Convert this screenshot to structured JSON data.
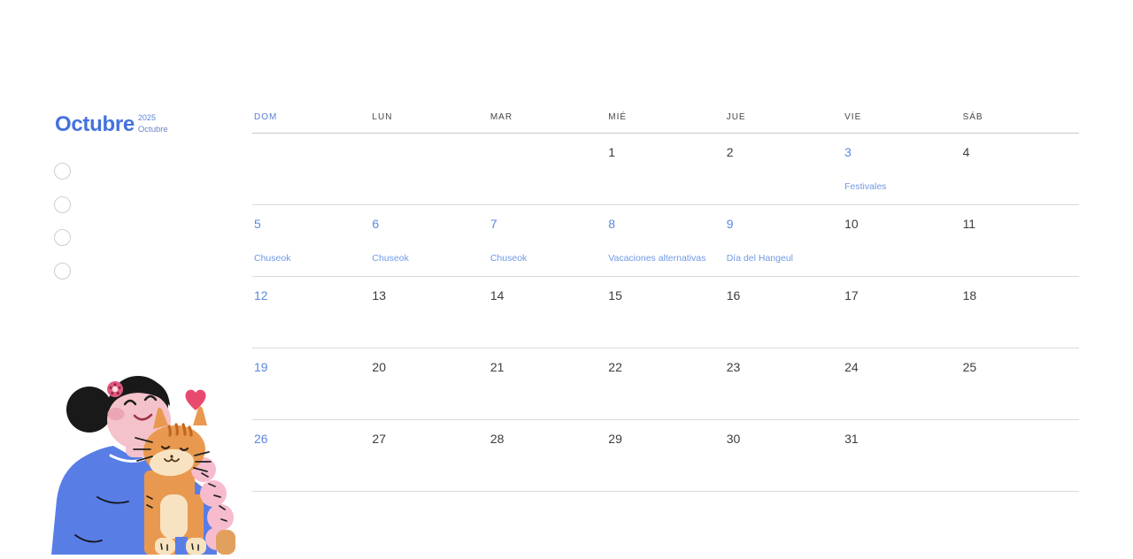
{
  "header": {
    "month_title": "Octubre",
    "year_small": "2025",
    "month_small": "Octubre"
  },
  "weekday_headers": [
    {
      "label": "DOM",
      "accent": true
    },
    {
      "label": "LUN",
      "accent": false
    },
    {
      "label": "MAR",
      "accent": false
    },
    {
      "label": "MIÉ",
      "accent": false
    },
    {
      "label": "JUE",
      "accent": false
    },
    {
      "label": "VIE",
      "accent": false
    },
    {
      "label": "SÁB",
      "accent": false
    }
  ],
  "calendar": {
    "weeks": [
      [
        {
          "day": ""
        },
        {
          "day": ""
        },
        {
          "day": ""
        },
        {
          "day": "1"
        },
        {
          "day": "2"
        },
        {
          "day": "3",
          "accent": true,
          "event": "Festivales"
        },
        {
          "day": "4"
        }
      ],
      [
        {
          "day": "5",
          "accent": true,
          "event": "Chuseok"
        },
        {
          "day": "6",
          "accent": true,
          "event": "Chuseok"
        },
        {
          "day": "7",
          "accent": true,
          "event": "Chuseok"
        },
        {
          "day": "8",
          "accent": true,
          "event": "Vacaciones alternativas"
        },
        {
          "day": "9",
          "accent": true,
          "event": "Día del Hangeul"
        },
        {
          "day": "10"
        },
        {
          "day": "11"
        }
      ],
      [
        {
          "day": "12",
          "accent": true
        },
        {
          "day": "13"
        },
        {
          "day": "14"
        },
        {
          "day": "15"
        },
        {
          "day": "16"
        },
        {
          "day": "17"
        },
        {
          "day": "18"
        }
      ],
      [
        {
          "day": "19",
          "accent": true
        },
        {
          "day": "20"
        },
        {
          "day": "21"
        },
        {
          "day": "22"
        },
        {
          "day": "23"
        },
        {
          "day": "24"
        },
        {
          "day": "25"
        }
      ],
      [
        {
          "day": "26",
          "accent": true
        },
        {
          "day": "27"
        },
        {
          "day": "28"
        },
        {
          "day": "29"
        },
        {
          "day": "30"
        },
        {
          "day": "31"
        },
        {
          "day": ""
        }
      ]
    ]
  },
  "todo": {
    "circle_count": 4
  },
  "illustration": {
    "name": "woman-hugging-cat",
    "palette": {
      "hair": "#191919",
      "skin": "#f4c2cb",
      "cheek": "#eca5b4",
      "shirt_blue": "#587ee6",
      "cat_orange": "#e9994f",
      "cat_stripe": "#c4661f",
      "cat_cream": "#f7e3c1",
      "arm_pink": "#f6bccd",
      "hand_tan": "#e2a05e",
      "heart": "#e84a6f",
      "flower": "#e05a80"
    }
  },
  "colors": {
    "accent_title": "#4472dd",
    "accent_sub": "#5f83d8",
    "accent_sub_2": "#6d83c4",
    "weekday_accent": "#5b7fd6",
    "weekday_text": "#46464a",
    "day_text": "#3c3c40",
    "day_accent": "#5c88df",
    "event_text": "#6f99e4",
    "grid_line": "#dadade",
    "header_line": "#c9c9cc",
    "circle_border": "#cdced3"
  }
}
